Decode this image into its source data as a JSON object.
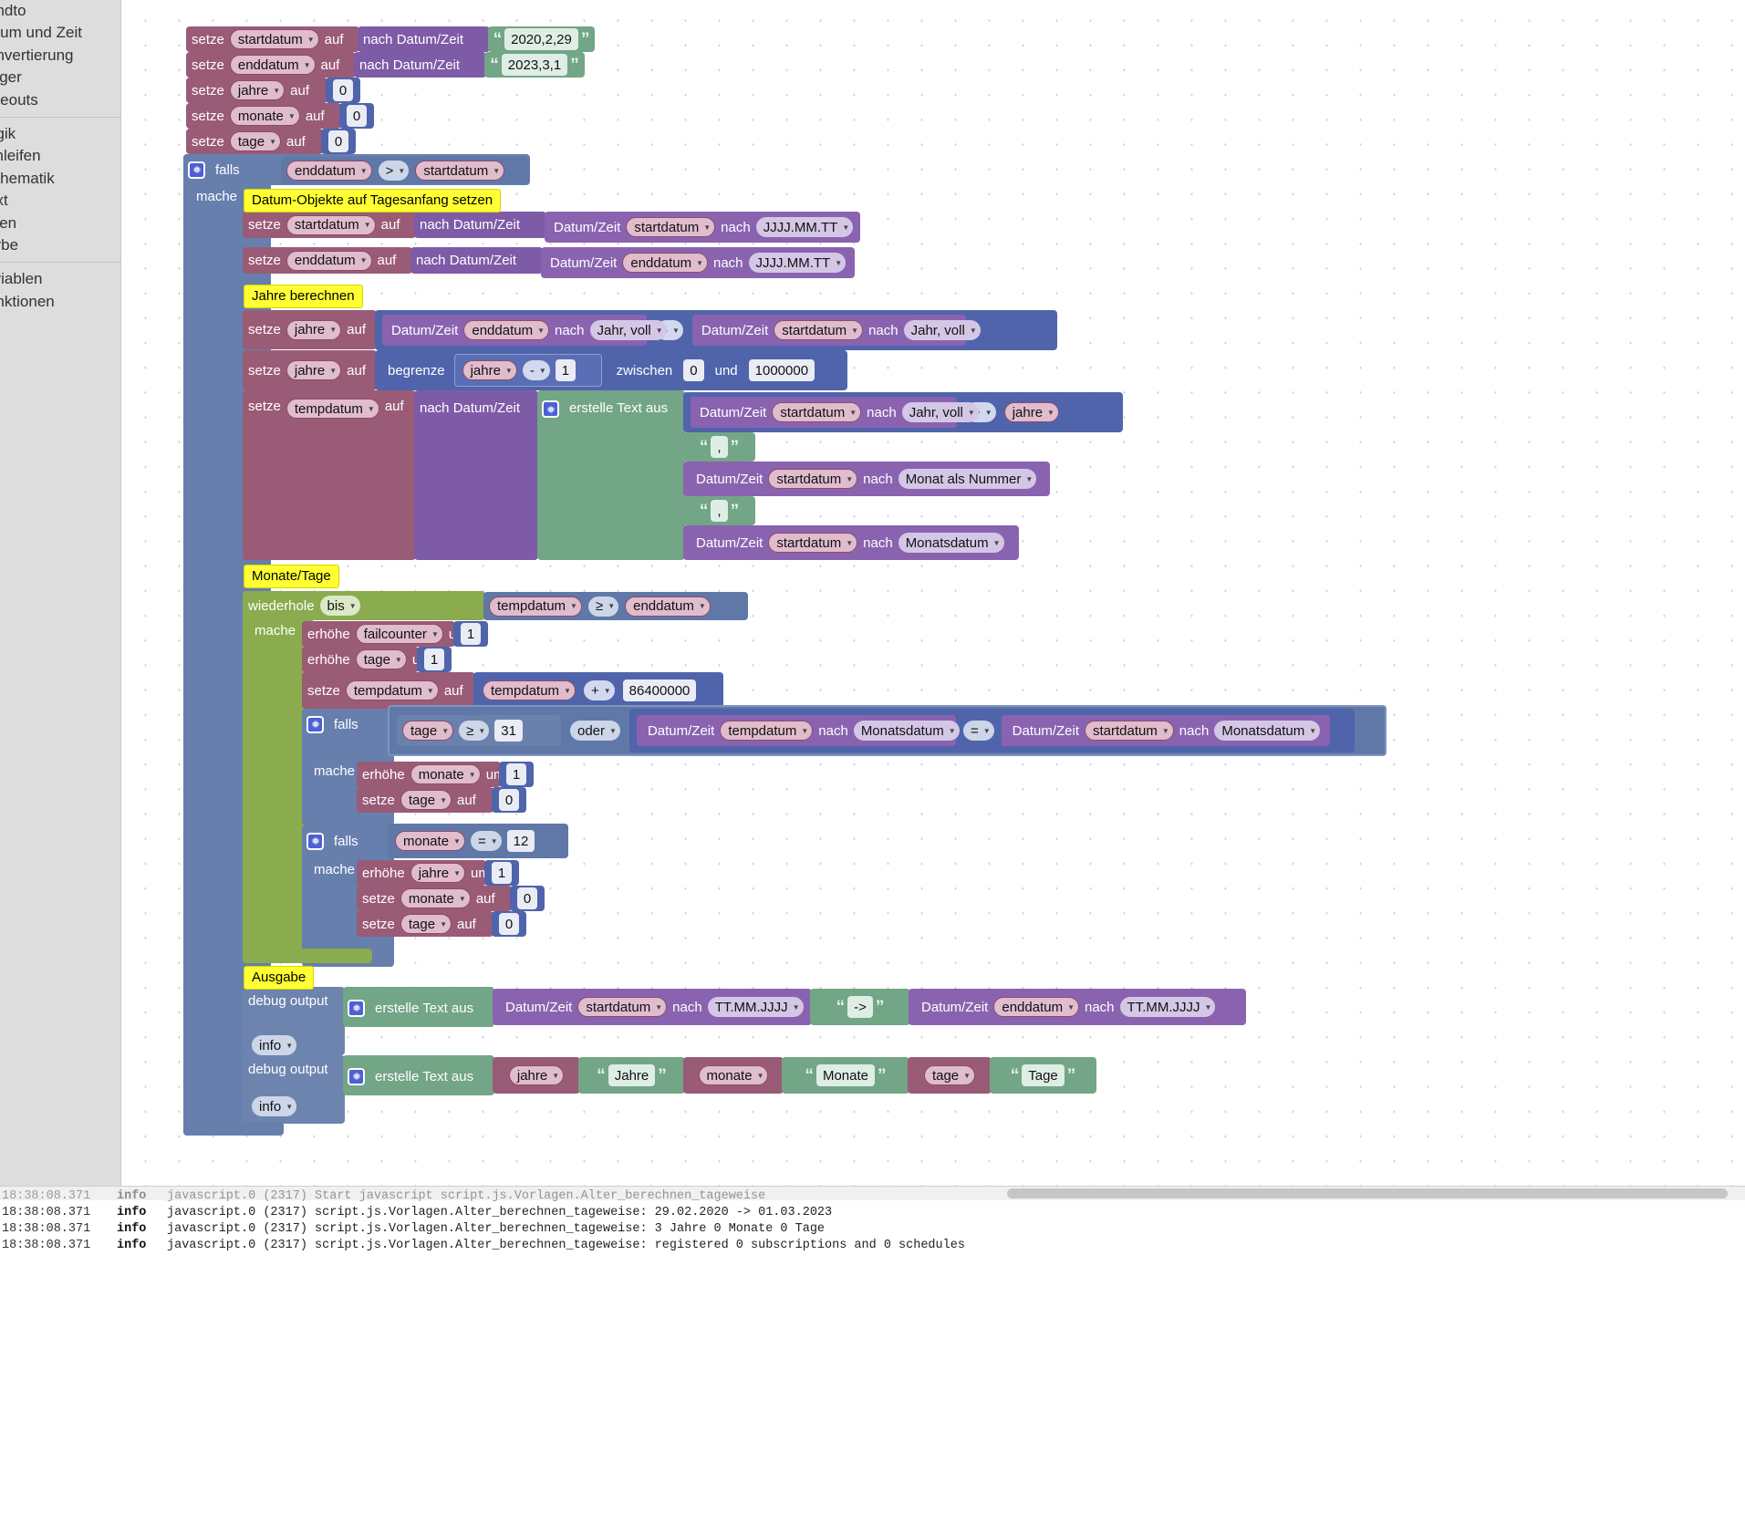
{
  "toolbox": {
    "items": [
      {
        "label": "endto",
        "truncated": true
      },
      {
        "label": "atum und Zeit",
        "truncated": true
      },
      {
        "label": "onvertierung",
        "truncated": true
      },
      {
        "label": "igger",
        "truncated": true
      },
      {
        "label": "meouts",
        "truncated": true
      },
      {
        "label": "ogik",
        "truncated": true
      },
      {
        "label": "chleifen",
        "truncated": true
      },
      {
        "label": "athematik",
        "truncated": true
      },
      {
        "label": "ext",
        "truncated": true
      },
      {
        "label": "sten",
        "truncated": true
      },
      {
        "label": "arbe",
        "truncated": true
      },
      {
        "label": "ariablen",
        "truncated": true
      },
      {
        "label": "unktionen",
        "truncated": true
      }
    ]
  },
  "words": {
    "setze": "setze",
    "auf": "auf",
    "nach_datum_zeit": "nach Datum/Zeit",
    "datum_zeit": "Datum/Zeit",
    "nach": "nach",
    "falls": "falls",
    "mache": "mache",
    "erhoehe": "erhöhe",
    "um": "um",
    "begrenze": "begrenze",
    "zwischen": "zwischen",
    "und": "und",
    "erstelle_text_aus": "erstelle Text aus",
    "wiederhole": "wiederhole",
    "oder": "oder",
    "debug_output": "debug output"
  },
  "vars": {
    "startdatum": "startdatum",
    "enddatum": "enddatum",
    "jahre": "jahre",
    "monate": "monate",
    "tage": "tage",
    "tempdatum": "tempdatum",
    "failcounter": "failcounter"
  },
  "values": {
    "start_literal": "2020,2,29",
    "end_literal": "2023,3,1",
    "zero": "0",
    "one": "1",
    "twelve": "12",
    "thirtyone": "31",
    "million": "1000000",
    "day_ms": "86400000",
    "comma": ",",
    "arrow": "->"
  },
  "formats": {
    "jjjj_mm_tt": "JJJJ.MM.TT",
    "tt_mm_jjjj": "TT.MM.JJJJ",
    "jahr_voll": "Jahr, voll",
    "monat_als_nummer": "Monat als Nummer",
    "monatsdatum": "Monatsdatum"
  },
  "ops": {
    "gt": ">",
    "ge": "≥",
    "eq": "=",
    "minus": "-",
    "plus": "+",
    "bis": "bis"
  },
  "notes": {
    "tagesanfang": "Datum-Objekte auf Tagesanfang setzen",
    "jahre_berechnen": "Jahre berechnen",
    "monate_tage": "Monate/Tage",
    "ausgabe": "Ausgabe"
  },
  "debug": {
    "level": "info",
    "label_jahre": "Jahre",
    "label_monate": "Monate",
    "label_tage": "Tage"
  },
  "console": {
    "rows": [
      {
        "ts": "18:38:08.371",
        "sev": "info",
        "msg": "javascript.0 (2317) Start javascript script.js.Vorlagen.Alter_berechnen_tageweise",
        "faded": true
      },
      {
        "ts": "18:38:08.371",
        "sev": "info",
        "msg": "javascript.0 (2317) script.js.Vorlagen.Alter_berechnen_tageweise: 29.02.2020 -> 01.03.2023",
        "faded": false
      },
      {
        "ts": "18:38:08.371",
        "sev": "info",
        "msg": "javascript.0 (2317) script.js.Vorlagen.Alter_berechnen_tageweise: 3 Jahre 0 Monate 0 Tage",
        "faded": false
      },
      {
        "ts": "18:38:08.371",
        "sev": "info",
        "msg": "javascript.0 (2317) script.js.Vorlagen.Alter_berechnen_tageweise: registered 0 subscriptions and 0 schedules",
        "faded": false
      }
    ]
  }
}
